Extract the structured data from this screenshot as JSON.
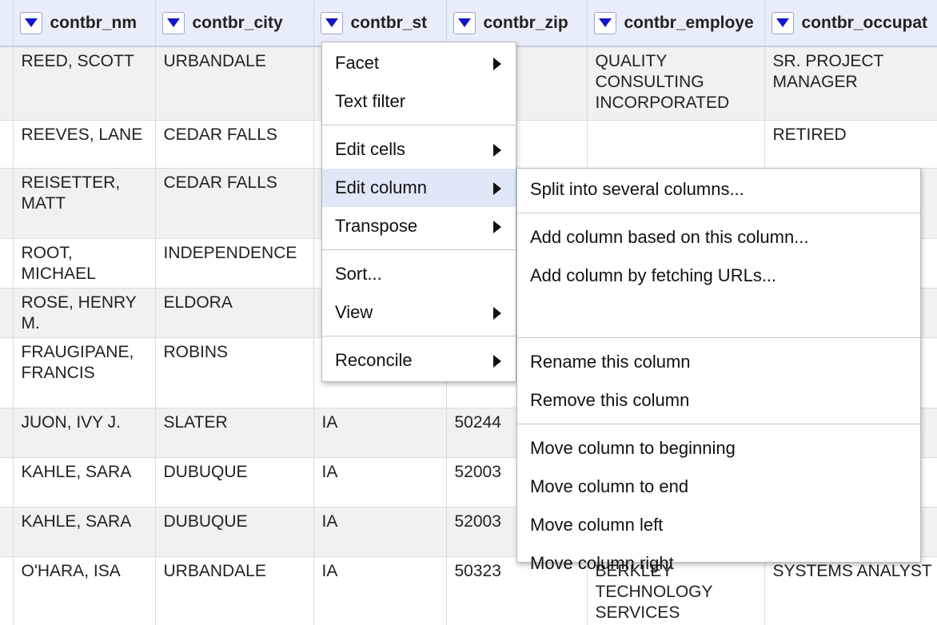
{
  "columns": [
    "contbr_nm",
    "contbr_city",
    "contbr_st",
    "contbr_zip",
    "contbr_employe",
    "contbr_occupat"
  ],
  "rows": [
    [
      "REED, SCOTT",
      "URBANDALE",
      "",
      "",
      "QUALITY CONSULTING INCORPORATED",
      "SR. PROJECT MANAGER"
    ],
    [
      "REEVES, LANE",
      "CEDAR FALLS",
      "",
      "",
      "",
      "RETIRED"
    ],
    [
      "REISETTER, MATT",
      "CEDAR FALLS",
      "",
      "",
      "",
      ""
    ],
    [
      "ROOT, MICHAEL",
      "INDEPENDENCE",
      "",
      "",
      "",
      ""
    ],
    [
      "ROSE, HENRY M.",
      "ELDORA",
      "",
      "",
      "",
      ""
    ],
    [
      "FRAUGIPANE, FRANCIS",
      "ROBINS",
      "",
      "",
      "",
      ""
    ],
    [
      "JUON, IVY J.",
      "SLATER",
      "IA",
      "50244",
      "",
      ""
    ],
    [
      "KAHLE, SARA",
      "DUBUQUE",
      "IA",
      "52003",
      "",
      ""
    ],
    [
      "KAHLE, SARA",
      "DUBUQUE",
      "IA",
      "52003",
      "",
      ""
    ],
    [
      "O'HARA, ISA",
      "URBANDALE",
      "IA",
      "50323",
      "BERKLEY TECHNOLOGY SERVICES",
      "SYSTEMS ANALYST"
    ]
  ],
  "column_menu": {
    "items": [
      "Facet",
      "Text filter",
      "Edit cells",
      "Edit column",
      "Transpose",
      "Sort...",
      "View",
      "Reconcile"
    ]
  },
  "edit_column_submenu": {
    "items": [
      "Split into several columns...",
      "Add column based on this column...",
      "Add column by fetching URLs...",
      "Rename this column",
      "Remove this column",
      "Move column to beginning",
      "Move column to end",
      "Move column left",
      "Move column right"
    ]
  },
  "icons": {
    "column_dropdown": "triangle-down-icon",
    "submenu": "triangle-right-icon"
  },
  "colors": {
    "header_bg": "#e8eef9",
    "dropdown_arrow": "#1515c8",
    "menu_highlight": "#dfe8f6",
    "alt_row_bg": "#f1f1f1"
  }
}
